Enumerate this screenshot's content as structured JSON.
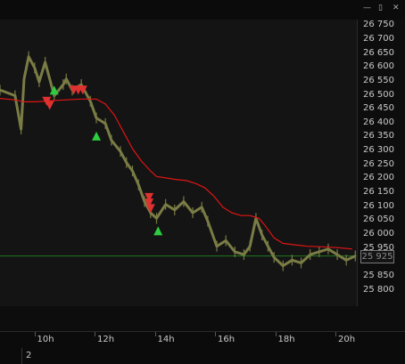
{
  "window": {
    "minimize_label": "—",
    "restore_label": "▯",
    "close_label": "✕"
  },
  "footer": {
    "page_number": "2"
  },
  "colors": {
    "background": "#141414",
    "candles": "#7a7c45",
    "moving_average": "#e01414",
    "reference_line": "#1f7a1f",
    "buy_marker": "#2ecc40",
    "sell_marker": "#e03131"
  },
  "chart_data": {
    "type": "line",
    "title": "",
    "xlabel": "",
    "ylabel": "",
    "x_ticks": [
      "10h",
      "12h",
      "14h",
      "16h",
      "18h",
      "20h"
    ],
    "x_tick_hours": [
      10,
      12,
      14,
      16,
      18,
      20
    ],
    "x_range": [
      8.8,
      20.65
    ],
    "y_ticks": [
      "26 750",
      "26 700",
      "26 650",
      "26 600",
      "26 550",
      "26 500",
      "26 450",
      "26 400",
      "26 350",
      "26 300",
      "26 250",
      "26 200",
      "26 150",
      "26 100",
      "26 050",
      "26 000",
      "25 950",
      "25 900",
      "25 850",
      "25 800"
    ],
    "y_tick_values": [
      26750,
      26700,
      26650,
      26600,
      26550,
      26500,
      26450,
      26400,
      26350,
      26300,
      26250,
      26200,
      26150,
      26100,
      26050,
      26000,
      25950,
      25900,
      25850,
      25800
    ],
    "ylim": [
      25745,
      26773
    ],
    "last_price": "25 925",
    "last_price_value": 25925,
    "grid": false,
    "series": [
      {
        "kind": "price",
        "x": [
          8.8,
          9.3,
          9.5,
          9.6,
          9.75,
          9.95,
          10.1,
          10.3,
          10.6,
          10.9,
          11.0,
          11.2,
          11.5,
          11.8,
          12.0,
          12.3,
          12.5,
          12.8,
          13.0,
          13.2,
          13.4,
          13.6,
          13.8,
          14.0,
          14.3,
          14.6,
          14.9,
          15.2,
          15.5,
          15.7,
          16.0,
          16.3,
          16.6,
          16.9,
          17.1,
          17.3,
          17.5,
          17.7,
          17.9,
          18.2,
          18.5,
          18.8,
          19.1,
          19.4,
          19.7,
          20.0,
          20.3,
          20.6
        ],
        "y": [
          26520,
          26500,
          26380,
          26560,
          26640,
          26600,
          26550,
          26620,
          26500,
          26540,
          26560,
          26520,
          26540,
          26480,
          26420,
          26400,
          26340,
          26300,
          26260,
          26230,
          26180,
          26120,
          26080,
          26060,
          26110,
          26090,
          26120,
          26080,
          26100,
          26050,
          25960,
          25980,
          25940,
          25930,
          25960,
          26060,
          26000,
          25960,
          25920,
          25890,
          25910,
          25900,
          25930,
          25940,
          25950,
          25930,
          25910,
          25925
        ]
      },
      {
        "kind": "moving_average",
        "x": [
          8.8,
          9.3,
          9.6,
          10.0,
          10.5,
          11.0,
          11.5,
          12.0,
          12.3,
          12.6,
          12.9,
          13.2,
          13.5,
          13.8,
          14.0,
          14.3,
          14.6,
          15.0,
          15.3,
          15.6,
          15.9,
          16.2,
          16.5,
          16.8,
          17.1,
          17.4,
          17.6,
          17.9,
          18.2,
          18.6,
          19.0,
          19.5,
          20.0,
          20.5
        ],
        "y": [
          26490,
          26485,
          26478,
          26478,
          26482,
          26485,
          26488,
          26488,
          26470,
          26430,
          26370,
          26310,
          26265,
          26230,
          26210,
          26205,
          26200,
          26195,
          26185,
          26170,
          26140,
          26100,
          26080,
          26070,
          26070,
          26060,
          26035,
          25990,
          25970,
          25965,
          25960,
          25958,
          25955,
          25950
        ]
      }
    ],
    "reference_lines": [
      {
        "y": 25925
      }
    ],
    "markers": [
      {
        "type": "sell",
        "x": 10.35,
        "y": 26480
      },
      {
        "type": "sell",
        "x": 10.45,
        "y": 26465
      },
      {
        "type": "buy",
        "x": 10.6,
        "y": 26520
      },
      {
        "type": "sell",
        "x": 11.25,
        "y": 26520
      },
      {
        "type": "sell",
        "x": 11.4,
        "y": 26520
      },
      {
        "type": "sell",
        "x": 11.55,
        "y": 26520
      },
      {
        "type": "buy",
        "x": 12.0,
        "y": 26355
      },
      {
        "type": "sell",
        "x": 13.75,
        "y": 26135
      },
      {
        "type": "sell",
        "x": 13.75,
        "y": 26115
      },
      {
        "type": "sell",
        "x": 13.8,
        "y": 26095
      },
      {
        "type": "buy",
        "x": 14.05,
        "y": 26015
      }
    ]
  }
}
